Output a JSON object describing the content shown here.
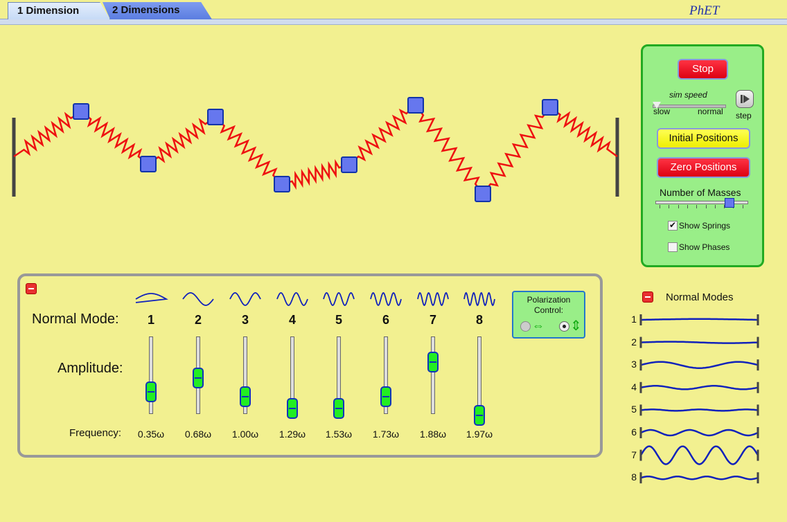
{
  "tabs": [
    {
      "label": "1 Dimension",
      "active": true
    },
    {
      "label": "2 Dimensions",
      "active": false
    }
  ],
  "brand": "PhET",
  "controls": {
    "stop_label": "Stop",
    "sim_speed_label": "sim speed",
    "slow_label": "slow",
    "normal_label": "normal",
    "step_label": "step",
    "initial_positions_label": "Initial Positions",
    "zero_positions_label": "Zero Positions",
    "number_of_masses_label": "Number of Masses",
    "number_of_masses_value": 8,
    "show_springs_label": "Show Springs",
    "show_springs_checked": true,
    "show_phases_label": "Show Phases",
    "show_phases_checked": false
  },
  "modes": {
    "normal_mode_label": "Normal Mode:",
    "amplitude_label": "Amplitude:",
    "frequency_label": "Frequency:",
    "list": [
      {
        "number": "1",
        "frequency": "0.35ω",
        "amplitude": 0.38
      },
      {
        "number": "2",
        "frequency": "0.68ω",
        "amplitude": 0.58
      },
      {
        "number": "3",
        "frequency": "1.00ω",
        "amplitude": 0.3
      },
      {
        "number": "4",
        "frequency": "1.29ω",
        "amplitude": 0.12
      },
      {
        "number": "5",
        "frequency": "1.53ω",
        "amplitude": 0.12
      },
      {
        "number": "6",
        "frequency": "1.73ω",
        "amplitude": 0.3
      },
      {
        "number": "7",
        "frequency": "1.88ω",
        "amplitude": 0.82
      },
      {
        "number": "8",
        "frequency": "1.97ω",
        "amplitude": 0.02
      }
    ]
  },
  "polarization": {
    "label": "Polarization Control:",
    "selected": "vertical"
  },
  "normal_modes_panel": {
    "title": "Normal Modes",
    "numbers": [
      "1",
      "2",
      "3",
      "4",
      "5",
      "6",
      "7",
      "8"
    ]
  },
  "colors": {
    "background": "#f2f090",
    "mass": "#6677ee",
    "spring": "#ee1111",
    "control_panel": "#99ee88",
    "slider_thumb": "#22ee22",
    "mode_wave": "#1122bb"
  },
  "icons": [
    "step-forward-icon",
    "minus-icon",
    "horizontal-arrow-icon",
    "vertical-arrow-icon",
    "checkmark-icon"
  ]
}
